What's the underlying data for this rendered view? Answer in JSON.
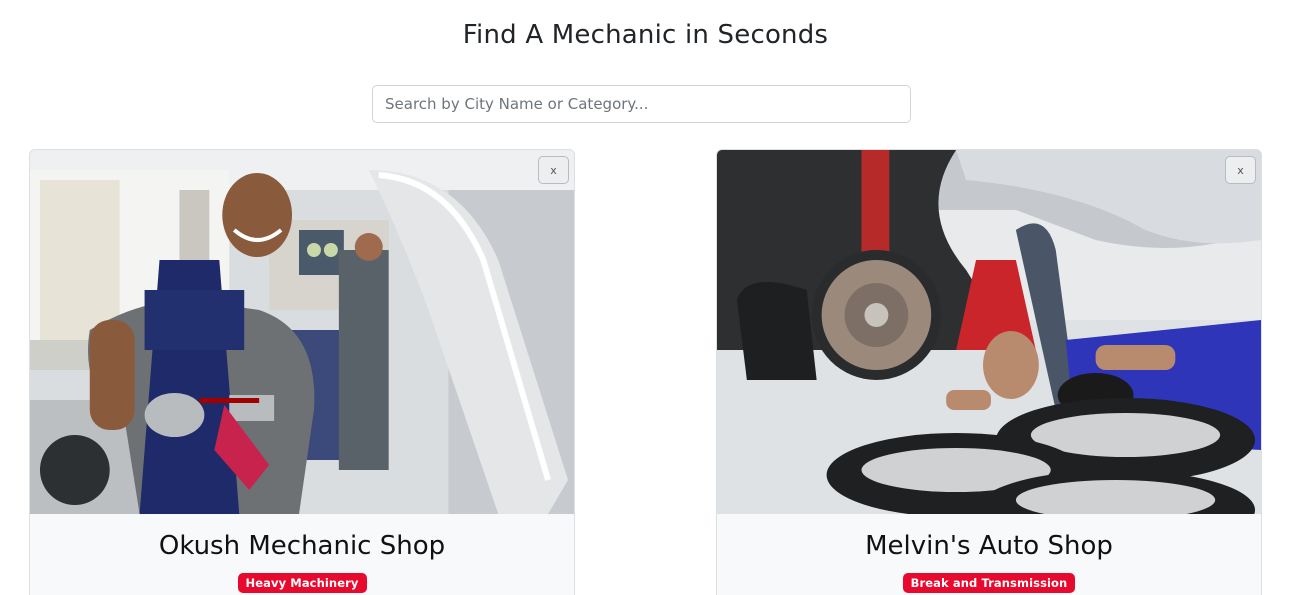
{
  "header": {
    "title": "Find A Mechanic in Seconds"
  },
  "search": {
    "placeholder": "Search by City Name or Category...",
    "value": ""
  },
  "cards": [
    {
      "name": "Okush Mechanic Shop",
      "category": "Heavy Machinery",
      "close_label": "x"
    },
    {
      "name": "Melvin's Auto Shop",
      "category": "Break and Transmission",
      "close_label": "x"
    }
  ],
  "colors": {
    "badge": "#e8092f",
    "card_bg": "#f8f9fa",
    "border": "#ced4da"
  }
}
